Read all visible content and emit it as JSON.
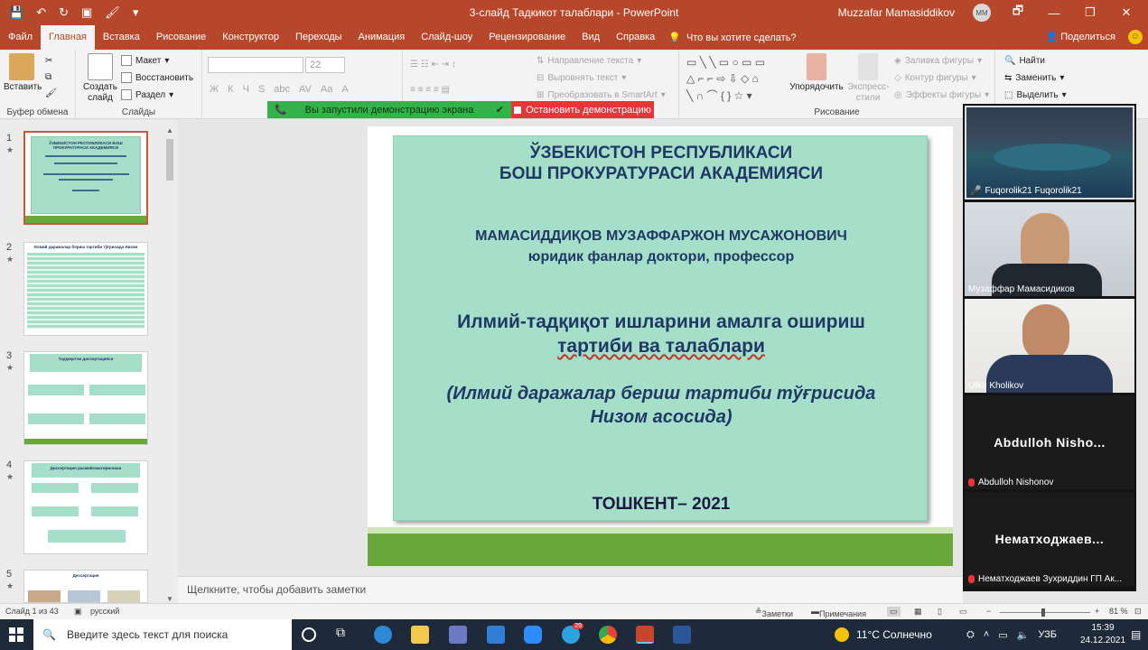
{
  "window": {
    "title": "3-слайд Тадкикот талаблари  -  PowerPoint",
    "user": "Muzzafar Mamasiddikov",
    "user_initials": "MM",
    "controls": [
      "—",
      "🗗",
      "—",
      "❐",
      "✕"
    ]
  },
  "quick_access": [
    "💾",
    "↶",
    "↻",
    "▣",
    "🖌",
    "▾"
  ],
  "tabs": [
    "Файл",
    "Главная",
    "Вставка",
    "Рисование",
    "Конструктор",
    "Переходы",
    "Анимация",
    "Слайд-шоу",
    "Рецензирование",
    "Вид",
    "Справка"
  ],
  "active_tab": "Главная",
  "tell_me": "Что вы хотите сделать?",
  "share": "Поделиться",
  "ribbon": {
    "paste": "Вставить",
    "clipboard_group": "Буфер обмена",
    "new_slide": "Создать слайд",
    "layout": "Макет",
    "reset": "Восстановить",
    "section": "Раздел",
    "slides_group": "Слайды",
    "font_size": "22",
    "font_buttons": [
      "Ж",
      "К",
      "Ч",
      "S",
      "abc",
      "AV",
      "Aa",
      "A"
    ],
    "text_direction": "Направление текста",
    "align_text": "Выровнять текст",
    "smartart": "Преобразовать в SmartArt",
    "arrange": "Упорядочить",
    "quick_styles": "Экспресс-стили",
    "shape_fill": "Заливка фигуры",
    "shape_outline": "Контур фигуры",
    "shape_effects": "Эффекты фигуры",
    "drawing_group": "Рисование",
    "find": "Найти",
    "replace": "Заменить",
    "select": "Выделить"
  },
  "screen_share": {
    "status": "Вы запустили демонстрацию экрана",
    "stop": "Остановить демонстрацию"
  },
  "thumbnails": [
    {
      "num": "1",
      "star": "★",
      "title": "ЎЗБЕКИСТОН РЕСПУБЛИКАСИ БОШ ПРОКУРАТУРАСИ АКАДЕМИЯСИ"
    },
    {
      "num": "2",
      "star": "★",
      "title": "Илмий даражалар бериш тартиби тўғрисида Низом"
    },
    {
      "num": "3",
      "star": "★",
      "title": "Тадқиқотчи диссертацияси"
    },
    {
      "num": "4",
      "star": "★",
      "title": "Диссертация расмийлаштирилиши"
    },
    {
      "num": "5",
      "star": "★",
      "title": "Диссертация"
    }
  ],
  "slide": {
    "line1": "ЎЗБЕКИСТОН РЕСПУБЛИКАСИ",
    "line2": "БОШ ПРОКУРАТУРАСИ АКАДЕМИЯСИ",
    "author": "МАМАСИДДИҚОВ МУЗАФФАРЖОН МУСАЖОНОВИЧ",
    "degree": "юридик фанлар доктори, профессор",
    "topic1": "Илмий-тадқиқот ишларини амалга ошириш",
    "topic2": "тартиби ва талаблари",
    "basis1": "(Илмий даражалар бериш тартиби тўғрисида",
    "basis2": "Низом асосида)",
    "city": "ТОШКЕНТ– 2021"
  },
  "notes_placeholder": "Щелкните, чтобы добавить заметки",
  "status": {
    "slide_count": "Слайд 1 из 43",
    "language": "русский",
    "notes": "Заметки",
    "comments": "Примечания",
    "zoom": "81 %"
  },
  "participants": [
    {
      "name": "Fuqorolik21 Fuqorolik21"
    },
    {
      "name": "Музаффар Мамасидиков"
    },
    {
      "name": "Utkir Kholikov"
    },
    {
      "name": "Abdulloh Nishonov",
      "display": "Abdulloh  Nisho..."
    },
    {
      "name": "Нематходжаев Зухриддин ГП Ак...",
      "display": "Нематходжаев..."
    }
  ],
  "taskbar": {
    "search": "Введите здесь текст для поиска",
    "weather": "11°C  Солнечно",
    "lang": "УЗБ",
    "time": "15:39",
    "date": "24.12.2021",
    "notification_badge": "29"
  },
  "colors": {
    "accent": "#b7472a",
    "slide_bg": "#a5dfca",
    "slide_text": "#1f3864",
    "slide_footer": "#6aa73b",
    "share_green": "#34b24a",
    "share_red": "#e8343b"
  }
}
